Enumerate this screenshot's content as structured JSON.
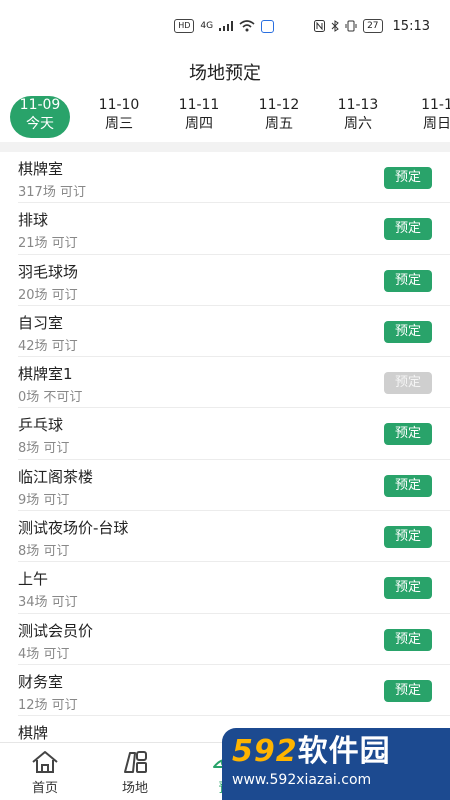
{
  "status_bar": {
    "hd": "HD",
    "network": "4G",
    "battery": "27",
    "time": "15:13"
  },
  "header": {
    "title": "场地预定"
  },
  "dates": [
    {
      "date": "11-09",
      "weekday": "今天",
      "active": true
    },
    {
      "date": "11-10",
      "weekday": "周三"
    },
    {
      "date": "11-11",
      "weekday": "周四"
    },
    {
      "date": "11-12",
      "weekday": "周五"
    },
    {
      "date": "11-13",
      "weekday": "周六"
    },
    {
      "date": "11-1",
      "weekday": "周日"
    }
  ],
  "venues": [
    {
      "name": "棋牌室",
      "count": "317场 可订",
      "button": "预定"
    },
    {
      "name": "排球",
      "count": "21场 可订",
      "button": "预定"
    },
    {
      "name": "羽毛球场",
      "count": "20场 可订",
      "button": "预定"
    },
    {
      "name": "自习室",
      "count": "42场 可订",
      "button": "预定"
    },
    {
      "name": "棋牌室1",
      "count": "0场 不可订",
      "button": "预定",
      "disabled": true
    },
    {
      "name": "乒乓球",
      "count": "8场 可订",
      "button": "预定"
    },
    {
      "name": "临江阁茶楼",
      "count": "9场 可订",
      "button": "预定"
    },
    {
      "name": "测试夜场价-台球",
      "count": "8场 可订",
      "button": "预定"
    },
    {
      "name": "上午",
      "count": "34场 可订",
      "button": "预定"
    },
    {
      "name": "测试会员价",
      "count": "4场 可订",
      "button": "预定"
    },
    {
      "name": "财务室",
      "count": "12场 可订",
      "button": "预定"
    },
    {
      "name": "棋牌",
      "count": "",
      "button": ""
    }
  ],
  "tab_bar": {
    "tabs": [
      {
        "label": "首页",
        "icon": "home-icon"
      },
      {
        "label": "场地",
        "icon": "venue-icon"
      },
      {
        "label": "预",
        "icon": "booking-icon",
        "active": true
      }
    ]
  },
  "watermark": {
    "logo_num": "592",
    "logo_text": "软件园",
    "url": "www.592xiazai.com"
  },
  "colors": {
    "accent": "#29a36a",
    "disabled": "#cfcfcf",
    "watermark_bg": "#1c4a90"
  }
}
